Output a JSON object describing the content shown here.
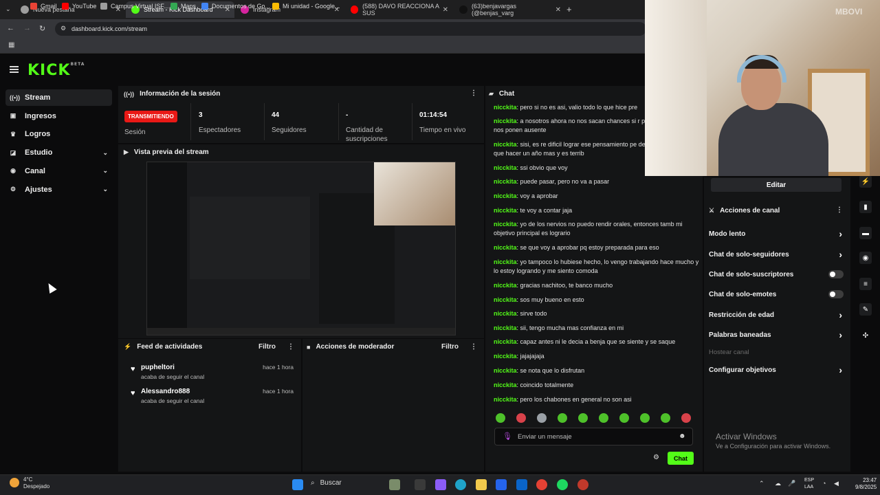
{
  "browser": {
    "tabs": [
      {
        "label": "Nueva pestaña",
        "active": false,
        "icon": "chrome-icon"
      },
      {
        "label": "Stream - Kick Dashboard",
        "active": true,
        "icon": "kick-icon"
      },
      {
        "label": "Instagram",
        "active": false,
        "icon": "instagram-icon"
      },
      {
        "label": "(588) DAVO REACCIONA A SUS",
        "active": false,
        "icon": "youtube-icon"
      },
      {
        "label": "(63)benjavargas (@benjas_varg",
        "active": false,
        "icon": "tiktok-icon"
      }
    ],
    "new_tab": "+",
    "url": "dashboard.kick.com/stream",
    "bookmarks": [
      {
        "label": "Gmail",
        "color": "#ea4335"
      },
      {
        "label": "YouTube",
        "color": "#ff0000"
      },
      {
        "label": "Campus Virtual ISF...",
        "color": "#9e9e9e"
      },
      {
        "label": "Maps",
        "color": "#34a853"
      },
      {
        "label": "Documentos de Go...",
        "color": "#4285f4"
      },
      {
        "label": "Mi unidad - Google...",
        "color": "#fbbc04"
      }
    ]
  },
  "app": {
    "logo": "KICK",
    "logo_sup": "BETA",
    "accent": "#53fc18",
    "sidebar": [
      {
        "label": "Stream",
        "icon": "broadcast-icon",
        "active": true
      },
      {
        "label": "Ingresos",
        "icon": "money-icon",
        "active": false
      },
      {
        "label": "Logros",
        "icon": "trophy-icon",
        "active": false
      },
      {
        "label": "Estudio",
        "icon": "studio-icon",
        "active": false,
        "expandable": true
      },
      {
        "label": "Canal",
        "icon": "channel-icon",
        "active": false,
        "expandable": true
      },
      {
        "label": "Ajustes",
        "icon": "gear-icon",
        "active": false,
        "expandable": true
      }
    ],
    "session": {
      "title": "Información de la sesión",
      "live_badge": "TRANSMITIENDO",
      "live_label": "Sesión",
      "stats": [
        {
          "value": "3",
          "label": "Espectadores"
        },
        {
          "value": "44",
          "label": "Seguidores"
        },
        {
          "value": "-",
          "label": "Cantidad de suscripciones"
        },
        {
          "value": "01:14:54",
          "label": "Tiempo en vivo"
        }
      ]
    },
    "preview": {
      "title": "Vista previa del stream"
    },
    "activity": {
      "title": "Feed de actividades",
      "filter": "Filtro",
      "items": [
        {
          "name": "pupheltori",
          "action": "acaba de seguir el canal",
          "time": "hace 1 hora"
        },
        {
          "name": "Alessandro888",
          "action": "acaba de seguir el canal",
          "time": "hace 1 hora"
        }
      ]
    },
    "moderator": {
      "title": "Acciones de moderador",
      "filter": "Filtro"
    },
    "chat": {
      "title": "Chat",
      "messages": [
        {
          "user": "nicckita",
          "text": "pero si no es asi, valio todo lo que hice pre"
        },
        {
          "user": "nicckita",
          "text": "a nosotros ahora no nos sacan chances si r presentamos, solo nos ponen ausente"
        },
        {
          "user": "nicckita",
          "text": "sisi, es re dificil lograr ese pensamiento pe desaprueb tendria que hacer un año mas y es terrib"
        },
        {
          "user": "nicckita",
          "text": "ssi obvio que voy"
        },
        {
          "user": "nicckita",
          "text": "puede pasar, pero no va a pasar"
        },
        {
          "user": "nicckita",
          "text": "voy a aprobar"
        },
        {
          "user": "nicckita",
          "text": "te voy a contar jaja"
        },
        {
          "user": "nicckita",
          "text": "yo de los nervios no puedo rendir orales, entonces tamb mi objetivo principal es logrario"
        },
        {
          "user": "nicckita",
          "text": "se que voy a aprobar pq estoy preparada para eso"
        },
        {
          "user": "nicckita",
          "text": "yo tampoco lo hubiese hecho, lo vengo trabajando hace mucho y lo estoy logrando y me siento comoda"
        },
        {
          "user": "nicckita",
          "text": "gracias nachitoo, te banco mucho"
        },
        {
          "user": "nicckita",
          "text": "sos muy bueno en esto"
        },
        {
          "user": "nicckita",
          "text": "sirve todo"
        },
        {
          "user": "nicckita",
          "text": "sii, tengo mucha mas confianza en mi"
        },
        {
          "user": "nicckita",
          "text": "capaz antes ni le decia a benja que se siente y se saque"
        },
        {
          "user": "nicckita",
          "text": "jajajajaja"
        },
        {
          "user": "nicckita",
          "text": "se nota que lo disfrutan"
        },
        {
          "user": "nicckita",
          "text": "coincido totalmente"
        },
        {
          "user": "nicckita",
          "text": "pero los chabones en general no son asi"
        }
      ],
      "input_placeholder": "Enviar un mensaje",
      "send_label": "Chat"
    },
    "channel_actions": {
      "edit_label": "Editar",
      "title": "Acciones de canal",
      "items": [
        {
          "label": "Modo lento",
          "type": "arrow"
        },
        {
          "label": "Chat de solo-seguidores",
          "type": "arrow"
        },
        {
          "label": "Chat de solo-suscriptores",
          "type": "toggle"
        },
        {
          "label": "Chat de solo-emotes",
          "type": "toggle"
        },
        {
          "label": "Restricción de edad",
          "type": "arrow"
        },
        {
          "label": "Palabras baneadas",
          "type": "arrow"
        },
        {
          "label": "Hostear canal",
          "type": "disabled"
        },
        {
          "label": "Configurar objetivos",
          "type": "arrow"
        }
      ]
    }
  },
  "overlay": {
    "watermark": "MBOVI",
    "activate_title": "Activar Windows",
    "activate_sub": "Ve a Configuración para activar Windows."
  },
  "taskbar": {
    "weather_temp": "4°C",
    "weather_desc": "Despejado",
    "search": "Buscar",
    "lang": "ESP",
    "lang2": "LAA",
    "time": "23:47",
    "date": "9/8/2025"
  }
}
